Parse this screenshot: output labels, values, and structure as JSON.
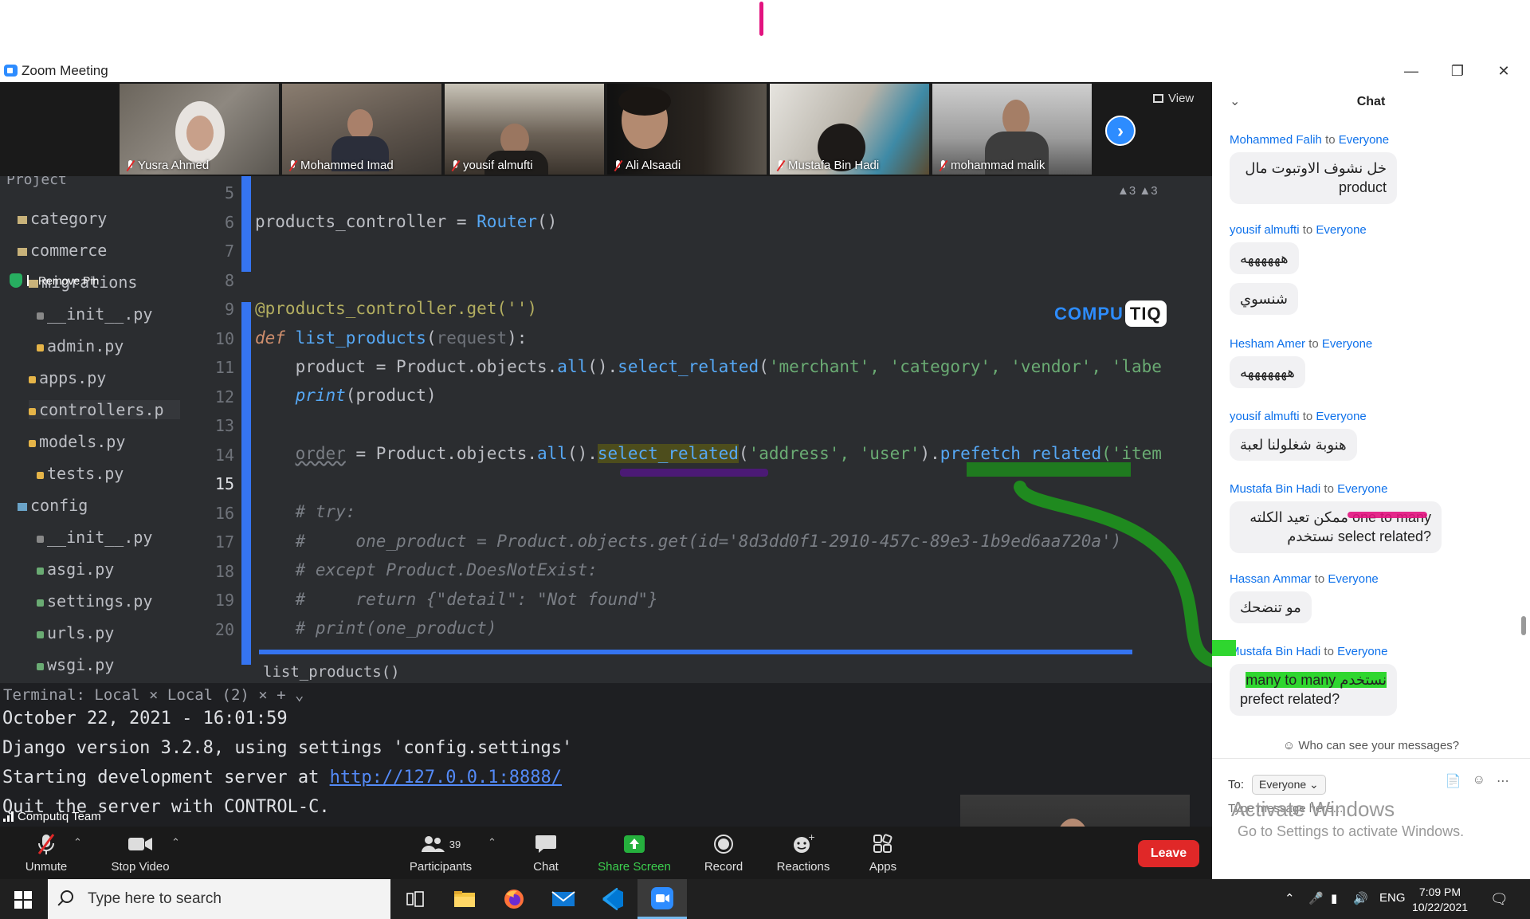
{
  "window": {
    "title": "Zoom Meeting"
  },
  "thumbnails": [
    {
      "name": "Yusra Ahmed"
    },
    {
      "name": "Mohammed Imad"
    },
    {
      "name": "yousif almufti"
    },
    {
      "name": "Ali Alsaadi"
    },
    {
      "name": "Mustafa Bin Hadi"
    },
    {
      "name": "mohammad malik"
    }
  ],
  "view_label": "View",
  "remove_pin": "Remove Pin",
  "ide": {
    "project_label": "Project",
    "tree": [
      "category",
      "commerce",
      "migrations",
      "__init__.py",
      "admin.py",
      "apps.py",
      "controllers.p",
      "models.py",
      "tests.py",
      "config",
      "__init__.py",
      "asgi.py",
      "settings.py",
      "urls.py",
      "wsgi.py"
    ],
    "line_numbers": [
      "5",
      "6",
      "7",
      "8",
      "9",
      "10",
      "11",
      "12",
      "13",
      "14",
      "15",
      "16",
      "17",
      "18",
      "19",
      "20"
    ],
    "lines": {
      "l6a": "products_controller = ",
      "l6b": "Router",
      "l6c": "()",
      "l9": "@products_controller.get('')",
      "l10a": "def ",
      "l10b": "list_products",
      "l10c": "(",
      "l10d": "request",
      "l10e": "):",
      "l11a": "    product = Product.objects.",
      "l11b": "all",
      "l11c": "().",
      "l11d": "select_related",
      "l11e": "(",
      "l11f": "'merchant', 'category', 'vendor', 'labe",
      "l12a": "    ",
      "l12b": "print",
      "l12c": "(product)",
      "l14a": "    ",
      "l14b": "order",
      "l14c": " = Product.objects.",
      "l14d": "all",
      "l14e": "().",
      "l14f": "select_related",
      "l14g": "(",
      "l14h": "'address', 'user'",
      "l14i": ").",
      "l14j": "prefetch_related",
      "l14k": "('item",
      "l16": "    # try:",
      "l17": "    #     one_product = Product.objects.get(id='8d3dd0f1-2910-457c-89e3-1b9ed6aa720a')",
      "l18": "    # except Product.DoesNotExist:",
      "l19": "    #     return {\"detail\": \"Not found\"}",
      "l20": "    # print(one_product)"
    },
    "breadcrumb": "list_products()",
    "inspections": "▲3 ▲3"
  },
  "brand": {
    "left": "COMPU",
    "right": "TIQ"
  },
  "terminal": {
    "header": "Terminal:  Local ×  Local (2) ×  +  ⌄",
    "line1": "October 22, 2021 - 16:01:59",
    "line2": "Django version 3.2.8, using settings 'config.settings'",
    "line3a": "Starting development server at ",
    "line3b": "http://127.0.0.1:8888/",
    "line4": "Quit the server with CONTROL-C."
  },
  "team_label": "Computiq Team",
  "controls": {
    "unmute": "Unmute",
    "stop_video": "Stop Video",
    "participants": "Participants",
    "participant_count": "39",
    "chat": "Chat",
    "share_screen": "Share Screen",
    "record": "Record",
    "reactions": "Reactions",
    "apps": "Apps",
    "leave": "Leave"
  },
  "chat": {
    "title": "Chat",
    "to_word": "to",
    "messages": [
      {
        "sender": "Mohammed Falih",
        "recipient": "Everyone",
        "text": "خل نشوف الاوتبوت مال product"
      },
      {
        "sender": "yousif almufti",
        "recipient": "Everyone",
        "text": "ههههههه"
      },
      {
        "text": "شنسوي"
      },
      {
        "sender": "Hesham Amer",
        "recipient": "Everyone",
        "text": "هههههههه"
      },
      {
        "sender": "yousif almufti",
        "recipient": "Everyone",
        "text": "هنوبة شغلولنا لعبة"
      },
      {
        "sender": "Mustafa Bin Hadi",
        "recipient": "Everyone",
        "text_a": "ممكن تعيد الكلته one to many",
        "text_b": "نستخدم select related?"
      },
      {
        "sender": "Hassan Ammar",
        "recipient": "Everyone",
        "text": "مو تنضحك"
      },
      {
        "sender": "Mustafa Bin Hadi",
        "recipient": "Everyone",
        "text_a": "many to many نستخدم",
        "text_b": "prefect related?"
      }
    ],
    "who_can_see": "Who can see your messages?",
    "to_label": "To:",
    "to_value": "Everyone",
    "placeholder": "Type message here..."
  },
  "watermark": {
    "line1": "Activate Windows",
    "line2": "Go to Settings to activate Windows."
  },
  "taskbar": {
    "search_placeholder": "Type here to search",
    "lang": "ENG",
    "time": "7:09 PM",
    "date": "10/22/2021"
  }
}
